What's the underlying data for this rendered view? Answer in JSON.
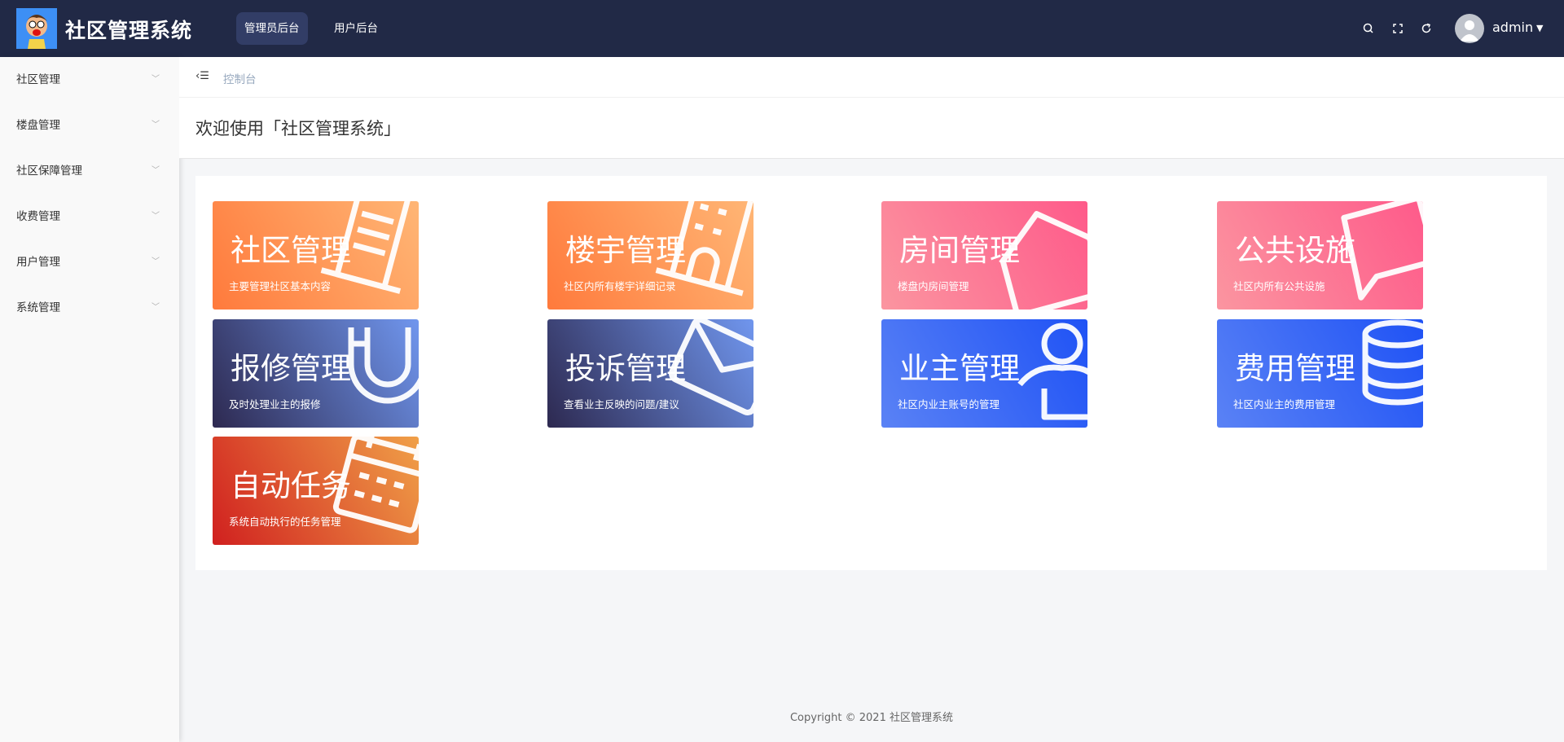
{
  "header": {
    "app_title": "社区管理系统",
    "nav": [
      {
        "label": "管理员后台",
        "active": true
      },
      {
        "label": "用户后台",
        "active": false
      }
    ],
    "icons": [
      "search-icon",
      "fullscreen-icon",
      "refresh-icon"
    ],
    "username": "admin"
  },
  "sidebar": {
    "items": [
      {
        "label": "社区管理"
      },
      {
        "label": "楼盘管理"
      },
      {
        "label": "社区保障管理"
      },
      {
        "label": "收费管理"
      },
      {
        "label": "用户管理"
      },
      {
        "label": "系统管理"
      }
    ]
  },
  "breadcrumb": {
    "current": "控制台"
  },
  "page_title": "欢迎使用「社区管理系统」",
  "cards": [
    {
      "title": "社区管理",
      "subtitle": "主要管理社区基本内容",
      "icon": "building-icon",
      "colors": [
        "#ff7a3c",
        "#ffb675"
      ]
    },
    {
      "title": "楼宇管理",
      "subtitle": "社区内所有楼宇详细记录",
      "icon": "office-building-icon",
      "colors": [
        "#ff7a3c",
        "#ffb675"
      ]
    },
    {
      "title": "房间管理",
      "subtitle": "楼盘内房间管理",
      "icon": "house-icon",
      "colors": [
        "#fb95a0",
        "#fe5a8a"
      ]
    },
    {
      "title": "公共设施",
      "subtitle": "社区内所有公共设施",
      "icon": "flag-icon",
      "colors": [
        "#fb95a0",
        "#fe5a8a"
      ]
    },
    {
      "title": "报修管理",
      "subtitle": "及时处理业主的报修",
      "icon": "magnet-icon",
      "colors": [
        "#2d2950",
        "#7096ee"
      ]
    },
    {
      "title": "投诉管理",
      "subtitle": "查看业主反映的问题/建议",
      "icon": "mail-icon",
      "colors": [
        "#2d2950",
        "#7096ee"
      ]
    },
    {
      "title": "业主管理",
      "subtitle": "社区内业主账号的管理",
      "icon": "user-icon",
      "colors": [
        "#5a82f5",
        "#1f52f5"
      ]
    },
    {
      "title": "费用管理",
      "subtitle": "社区内业主的费用管理",
      "icon": "coins-icon",
      "colors": [
        "#5a82f5",
        "#1f52f5"
      ]
    },
    {
      "title": "自动任务",
      "subtitle": "系统自动执行的任务管理",
      "icon": "calendar-icon",
      "colors": [
        "#d0201f",
        "#f0a048"
      ]
    }
  ],
  "footer": "Copyright © 2021 社区管理系统"
}
